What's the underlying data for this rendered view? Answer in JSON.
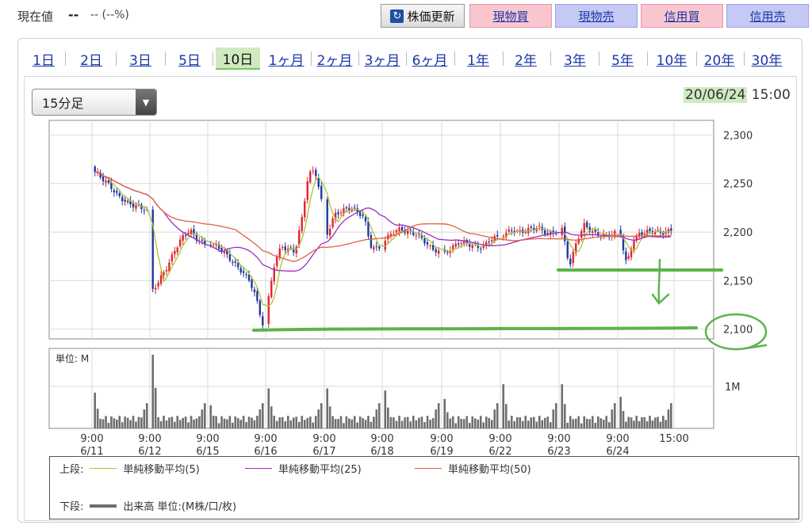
{
  "header": {
    "price_label": "現在値",
    "price_value": "--",
    "price_change": "-- (--%)",
    "refresh_label": "株価更新",
    "buttons": [
      "現物買",
      "現物売",
      "信用買",
      "信用売"
    ]
  },
  "period_tabs": [
    {
      "label": "1日"
    },
    {
      "label": "2日"
    },
    {
      "label": "3日"
    },
    {
      "label": "5日"
    },
    {
      "label": "10日",
      "active": true
    },
    {
      "label": "1ヶ月"
    },
    {
      "label": "2ヶ月"
    },
    {
      "label": "3ヶ月"
    },
    {
      "label": "6ヶ月"
    },
    {
      "label": "1年"
    },
    {
      "label": "2年"
    },
    {
      "label": "3年"
    },
    {
      "label": "5年"
    },
    {
      "label": "10年"
    },
    {
      "label": "20年"
    },
    {
      "label": "30年"
    }
  ],
  "interval": {
    "selected": "15分足"
  },
  "datetime": {
    "date": "20/06/24",
    "time": "15:00"
  },
  "colors": {
    "up": "#e4232b",
    "down": "#2038a0",
    "ma5": "#a9c438",
    "ma25": "#a02cc0",
    "ma50": "#e06040",
    "volume": "#6e6e6e",
    "grid": "#d9d9d9",
    "annotation": "#5cb44a",
    "highlight": "#cfeac0"
  },
  "chart_data": {
    "type": "candlestick",
    "price_ylim": [
      2090,
      2315
    ],
    "price_ticks": [
      2100,
      2150,
      2200,
      2250,
      2300
    ],
    "price_tick_labels": [
      "2,100",
      "2,150",
      "2,200",
      "2,250",
      "2,300"
    ],
    "volume_unit_label": "単位: M",
    "volume_tick_label": "1M",
    "volume_tick_value": 1.0,
    "volume_ylim": [
      0,
      1.9
    ],
    "x_labels": [
      {
        "time": "9:00",
        "date": "6/11"
      },
      {
        "time": "9:00",
        "date": "6/12"
      },
      {
        "time": "9:00",
        "date": "6/15"
      },
      {
        "time": "9:00",
        "date": "6/16"
      },
      {
        "time": "9:00",
        "date": "6/17"
      },
      {
        "time": "9:00",
        "date": "6/18"
      },
      {
        "time": "9:00",
        "date": "6/19"
      },
      {
        "time": "9:00",
        "date": "6/22"
      },
      {
        "time": "9:00",
        "date": "6/23"
      },
      {
        "time": "9:00",
        "date": "6/24"
      },
      {
        "time": "15:00",
        "date": ""
      }
    ],
    "bars_per_day": 20,
    "day_close_path": [
      [
        2262,
        2255,
        2248,
        2238,
        2232,
        2228,
        2226,
        2222
      ],
      [
        2140,
        2152,
        2165,
        2182,
        2195,
        2202,
        2192,
        2188
      ],
      [
        2188,
        2185,
        2180,
        2172,
        2165,
        2158,
        2150,
        2132,
        2105
      ],
      [
        2132,
        2172,
        2185,
        2182,
        2180,
        2212,
        2258,
        2265,
        2232
      ],
      [
        2198,
        2218,
        2222,
        2225,
        2222,
        2214,
        2182,
        2185
      ],
      [
        2192,
        2200,
        2203,
        2200,
        2198,
        2192,
        2183,
        2180
      ],
      [
        2178,
        2184,
        2190,
        2188,
        2185,
        2184,
        2192,
        2195
      ],
      [
        2198,
        2202,
        2200,
        2203,
        2205,
        2198,
        2200
      ],
      [
        2203,
        2165,
        2192,
        2208,
        2200,
        2197,
        2196,
        2199
      ],
      [
        2196,
        2166,
        2192,
        2198,
        2200,
        2201,
        2200,
        2199,
        2203
      ]
    ],
    "volume_shape": "daily U-shape with open spikes",
    "series": [
      {
        "name": "単純移動平均(5)",
        "key": "ma5"
      },
      {
        "name": "単純移動平均(25)",
        "key": "ma25"
      },
      {
        "name": "単純移動平均(50)",
        "key": "ma50"
      }
    ]
  },
  "legend": {
    "upper_label": "上段:",
    "lower_label": "下段:",
    "ma5": "単純移動平均(5)",
    "ma25": "単純移動平均(25)",
    "ma50": "単純移動平均(50)",
    "volume": "出来高 単位:(M株/口/枚)"
  }
}
